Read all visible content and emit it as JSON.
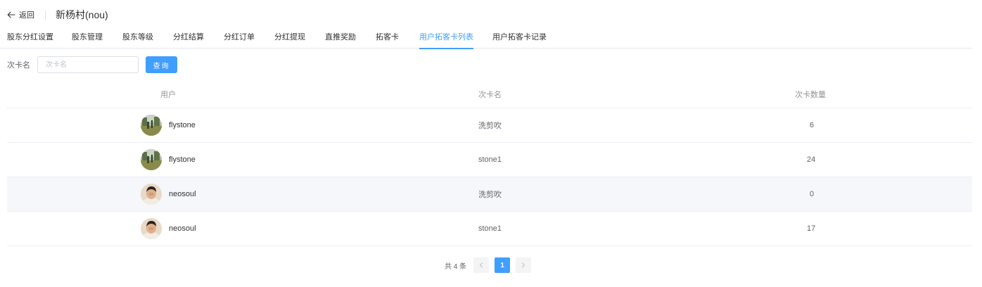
{
  "header": {
    "back_label": "返回",
    "title": "新杨村(nou)"
  },
  "tabs": [
    {
      "label": "股东分红设置",
      "active": false
    },
    {
      "label": "股东管理",
      "active": false
    },
    {
      "label": "股东等级",
      "active": false
    },
    {
      "label": "分红结算",
      "active": false
    },
    {
      "label": "分红订单",
      "active": false
    },
    {
      "label": "分红提现",
      "active": false
    },
    {
      "label": "直推奖励",
      "active": false
    },
    {
      "label": "拓客卡",
      "active": false
    },
    {
      "label": "用户拓客卡列表",
      "active": true
    },
    {
      "label": "用户拓客卡记录",
      "active": false
    }
  ],
  "filter": {
    "label": "次卡名",
    "placeholder": "次卡名",
    "value": "",
    "query_label": "查询"
  },
  "table": {
    "columns": [
      "用户",
      "次卡名",
      "次卡数量"
    ],
    "rows": [
      {
        "user": "flystone",
        "avatar": "landscape-avatar",
        "card": "洗剪吹",
        "count": "6"
      },
      {
        "user": "flystone",
        "avatar": "landscape-avatar",
        "card": "stone1",
        "count": "24"
      },
      {
        "user": "neosoul",
        "avatar": "portrait-avatar",
        "card": "洗剪吹",
        "count": "0"
      },
      {
        "user": "neosoul",
        "avatar": "portrait-avatar",
        "card": "stone1",
        "count": "17"
      }
    ]
  },
  "pagination": {
    "total_text": "共 4 条",
    "current_page": "1"
  },
  "colors": {
    "accent": "#409eff",
    "border": "#ebeef5",
    "hover_row": "#f5f7fa"
  }
}
